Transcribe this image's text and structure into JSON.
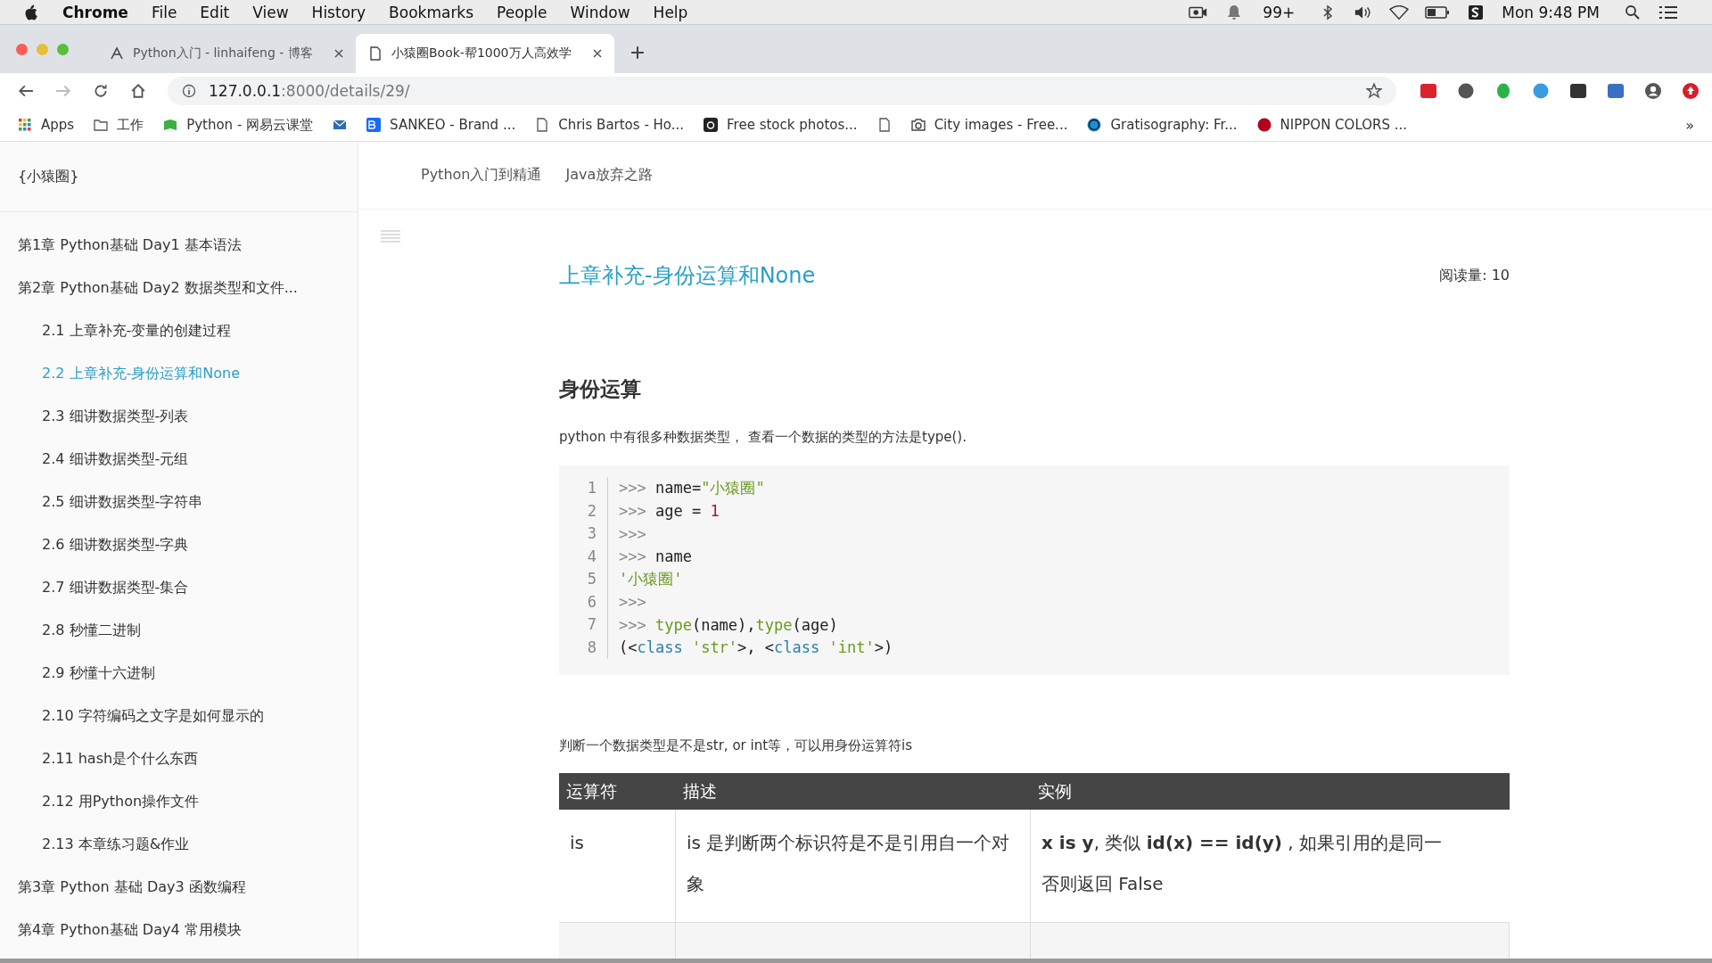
{
  "menubar": {
    "app": "Chrome",
    "menus": [
      "File",
      "Edit",
      "View",
      "History",
      "Bookmarks",
      "People",
      "Window",
      "Help"
    ],
    "notification_count": "99+",
    "clock": "Mon 9:48 PM"
  },
  "tabs": [
    {
      "title": "Python入门 - linhaifeng - 博客",
      "selected": false,
      "kind": "blog"
    },
    {
      "title": "小猿圈Book-帮1000万人高效学",
      "selected": true,
      "kind": "page"
    }
  ],
  "address": {
    "host": "127.0.0.1",
    "path": ":8000/details/29/"
  },
  "extensions": [
    {
      "kind": "fe"
    },
    {
      "kind": "e"
    },
    {
      "kind": "elephant"
    },
    {
      "kind": "wave"
    },
    {
      "kind": "dots"
    },
    {
      "kind": "translate"
    }
  ],
  "bookmarks": [
    {
      "kind": "apps",
      "label": "Apps"
    },
    {
      "kind": "folder",
      "label": "工作"
    },
    {
      "kind": "green",
      "label": "Python - 网易云课堂"
    },
    {
      "kind": "mail"
    },
    {
      "kind": "be",
      "label": "SANKEO - Brand ..."
    },
    {
      "kind": "page",
      "label": "Chris Bartos - Ho..."
    },
    {
      "kind": "camera-dark",
      "label": "Free stock photos..."
    },
    {
      "kind": "page"
    },
    {
      "kind": "camera",
      "label": "City images - Free..."
    },
    {
      "kind": "cc",
      "label": "Gratisography: Fr..."
    },
    {
      "kind": "red",
      "label": "NIPPON COLORS ..."
    }
  ],
  "bookmarks_more": "»",
  "sidebar": {
    "brand": "{小猿圈}",
    "items": [
      {
        "label": "第1章 Python基础 Day1 基本语法",
        "selected": false
      },
      {
        "label": "第2章 Python基础 Day2 数据类型和文件...",
        "selected": false,
        "children": [
          {
            "label": "2.1 上章补充-变量的创建过程",
            "selected": false
          },
          {
            "label": "2.2 上章补充-身份运算和None",
            "selected": true
          },
          {
            "label": "2.3 细讲数据类型-列表",
            "selected": false
          },
          {
            "label": "2.4 细讲数据类型-元组",
            "selected": false
          },
          {
            "label": "2.5 细讲数据类型-字符串",
            "selected": false
          },
          {
            "label": "2.6 细讲数据类型-字典",
            "selected": false
          },
          {
            "label": "2.7 细讲数据类型-集合",
            "selected": false
          },
          {
            "label": "2.8 秒懂二进制",
            "selected": false
          },
          {
            "label": "2.9 秒懂十六进制",
            "selected": false
          },
          {
            "label": "2.10 字符编码之文字是如何显示的",
            "selected": false
          },
          {
            "label": "2.11 hash是个什么东西",
            "selected": false
          },
          {
            "label": "2.12 用Python操作文件",
            "selected": false
          },
          {
            "label": "2.13 本章练习题&作业",
            "selected": false
          }
        ]
      },
      {
        "label": "第3章 Python 基础 Day3 函数编程",
        "selected": false
      },
      {
        "label": "第4章 Python基础 Day4 常用模块",
        "selected": false
      }
    ]
  },
  "topnav": [
    "Python入门到精通",
    "Java放弃之路"
  ],
  "article": {
    "title": "上章补充-身份运算和None",
    "read_count": "阅读量: 10",
    "heading": "身份运算",
    "intro": "python 中有很多种数据类型， 查看一个数据的类型的方法是type().",
    "code": [
      {
        "number": "1",
        "tokens": [
          {
            "kind": "prompt",
            "text": ">>> "
          },
          {
            "kind": "plain",
            "text": "name="
          },
          {
            "kind": "string",
            "text": "\"小猿圈\""
          }
        ]
      },
      {
        "number": "2",
        "tokens": [
          {
            "kind": "prompt",
            "text": ">>> "
          },
          {
            "kind": "plain",
            "text": "age = "
          },
          {
            "kind": "number",
            "text": "1"
          }
        ]
      },
      {
        "number": "3",
        "tokens": [
          {
            "kind": "prompt",
            "text": ">>>"
          }
        ]
      },
      {
        "number": "4",
        "tokens": [
          {
            "kind": "prompt",
            "text": ">>> "
          },
          {
            "kind": "plain",
            "text": "name"
          }
        ]
      },
      {
        "number": "5",
        "tokens": [
          {
            "kind": "string",
            "text": "'小猿圈'"
          }
        ]
      },
      {
        "number": "6",
        "tokens": [
          {
            "kind": "prompt",
            "text": ">>>"
          }
        ]
      },
      {
        "number": "7",
        "tokens": [
          {
            "kind": "prompt",
            "text": ">>> "
          },
          {
            "kind": "builtin",
            "text": "type"
          },
          {
            "kind": "plain",
            "text": "(name),"
          },
          {
            "kind": "builtin",
            "text": "type"
          },
          {
            "kind": "plain",
            "text": "(age)"
          }
        ]
      },
      {
        "number": "8",
        "tokens": [
          {
            "kind": "plain",
            "text": "(<"
          },
          {
            "kind": "keyword",
            "text": "class"
          },
          {
            "kind": "string",
            "text": " 'str'"
          },
          {
            "kind": "plain",
            "text": ">, <"
          },
          {
            "kind": "keyword",
            "text": "class"
          },
          {
            "kind": "string",
            "text": " 'int'"
          },
          {
            "kind": "plain",
            "text": ">)"
          }
        ]
      }
    ],
    "note": "判断一个数据类型是不是str, or int等，可以用身份运算符is",
    "table": {
      "columns": [
        "运算符",
        "描述",
        "实例"
      ],
      "rows": [
        {
          "operator": "is",
          "description": "is 是判断两个标识符是不是引用自一个对象",
          "example": [
            "**x is y**, 类似 **id(x) == id(y)** , 如果引用的是同一",
            "否则返回 False"
          ]
        }
      ]
    }
  }
}
